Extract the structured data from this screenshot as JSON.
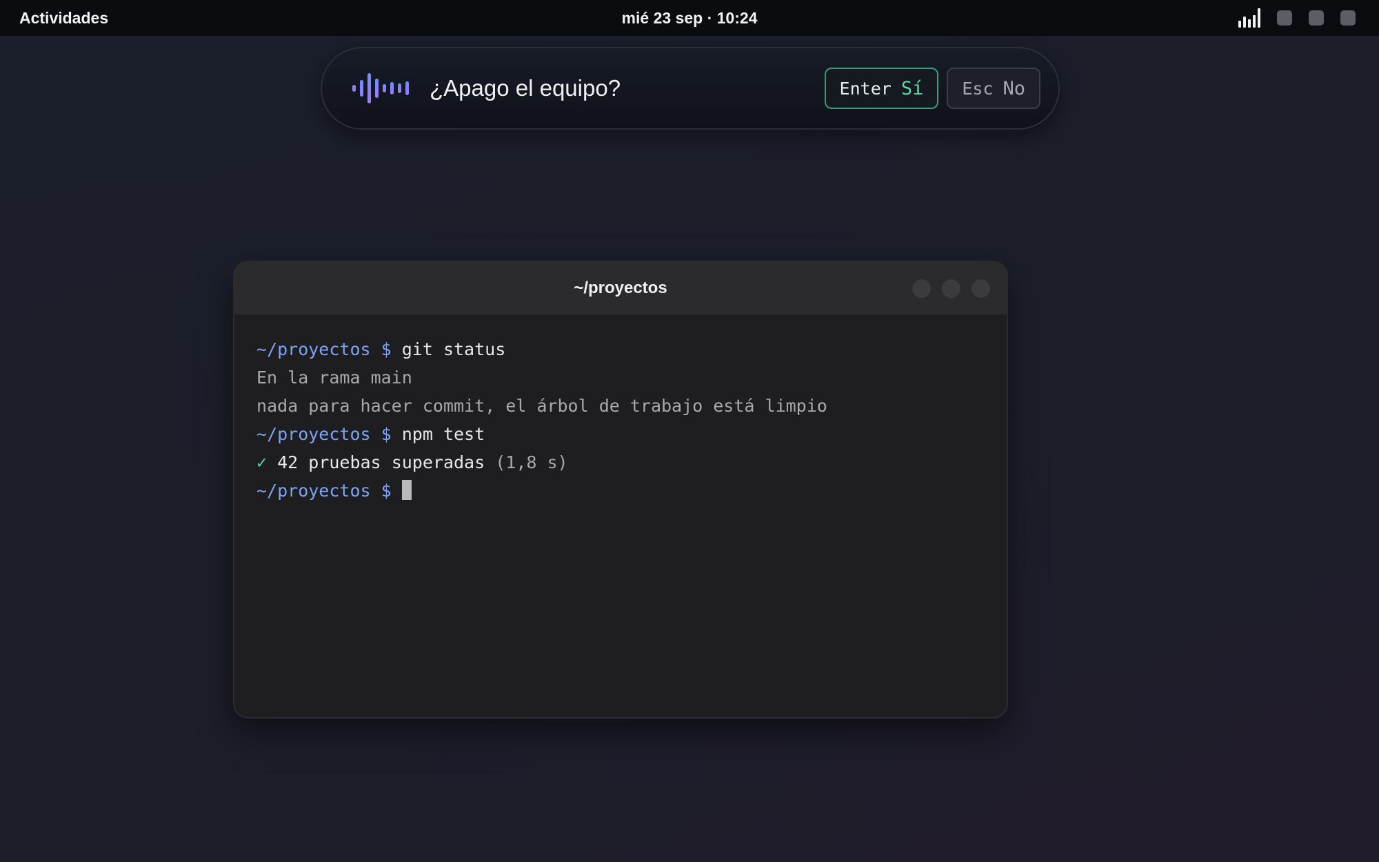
{
  "topbar": {
    "activities_label": "Actividades",
    "clock": "mié 23 sep · 10:24",
    "tray_icons": [
      "signal-icon",
      "tray-square-icon",
      "tray-square-icon",
      "tray-square-icon"
    ]
  },
  "voice_prompt": {
    "icon": "waveform-icon",
    "question": "¿Apago el equipo?",
    "confirm": {
      "key": "Enter",
      "label": "Sí",
      "accent": "#5fd6a2"
    },
    "cancel": {
      "key": "Esc",
      "label": "No"
    },
    "accent_gradient": [
      "#6f8cff",
      "#9c7bff"
    ]
  },
  "terminal": {
    "title": "~/proyectos",
    "prompt": "~/proyectos $",
    "lines": [
      {
        "prompt": "~/proyectos $",
        "command": "git status"
      },
      {
        "output": "En la rama main"
      },
      {
        "output": "nada para hacer commit, el árbol de trabajo está limpio"
      },
      {
        "prompt": "~/proyectos $",
        "command": "npm test"
      },
      {
        "check": "✓",
        "result": "42 pruebas superadas",
        "detail": "(1,8 s)"
      },
      {
        "prompt": "~/proyectos $",
        "command": ""
      }
    ]
  }
}
